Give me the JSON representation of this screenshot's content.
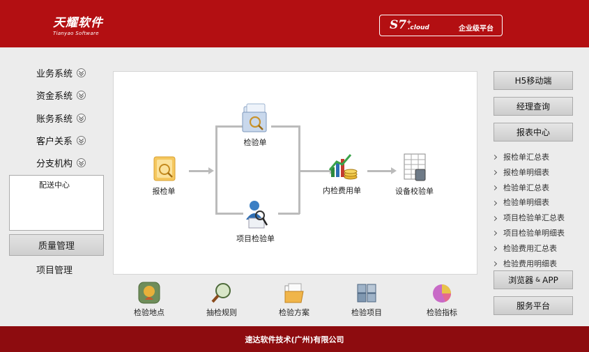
{
  "header": {
    "logo_cn": "天耀软件",
    "logo_en": "Tianyao Software",
    "brand_main": "S7",
    "brand_sup": "+",
    "brand_cloud": ".cloud",
    "brand_platform": "企业级平台"
  },
  "left_nav": {
    "items": [
      {
        "label": "业务系统"
      },
      {
        "label": "资金系统"
      },
      {
        "label": "账务系统"
      },
      {
        "label": "客户关系"
      },
      {
        "label": "分支机构"
      }
    ],
    "sub_panel_items": [
      "配送中心"
    ],
    "quality_label": "质量管理",
    "project_label": "项目管理"
  },
  "flow": {
    "bao_jian": "报检单",
    "jian_yan": "检验单",
    "xiang_mu": "项目检验单",
    "nei_jian": "内检费用单",
    "she_bei": "设备校验单"
  },
  "quick_bar": [
    {
      "label": "检验地点",
      "icon": "location-icon"
    },
    {
      "label": "抽检规则",
      "icon": "magnifier-icon"
    },
    {
      "label": "检验方案",
      "icon": "folder-icon"
    },
    {
      "label": "检验项目",
      "icon": "cubes-icon"
    },
    {
      "label": "检验指标",
      "icon": "pie-chart-icon"
    }
  ],
  "right_nav": {
    "h5": "H5移动端",
    "manager": "经理查询",
    "report_center": "报表中心",
    "reports": [
      "报检单汇总表",
      "报检单明细表",
      "检验单汇总表",
      "检验单明细表",
      "项目检验单汇总表",
      "项目检验单明细表",
      "检验费用汇总表",
      "检验费用明细表"
    ],
    "browser": "浏览器",
    "amp": "&",
    "app": "APP",
    "service": "服务平台"
  },
  "footer": {
    "text": "速达软件技术(广州)有限公司"
  },
  "colors": {
    "header": "#b30f12",
    "footer": "#8d0c0f",
    "background": "#ececec"
  }
}
